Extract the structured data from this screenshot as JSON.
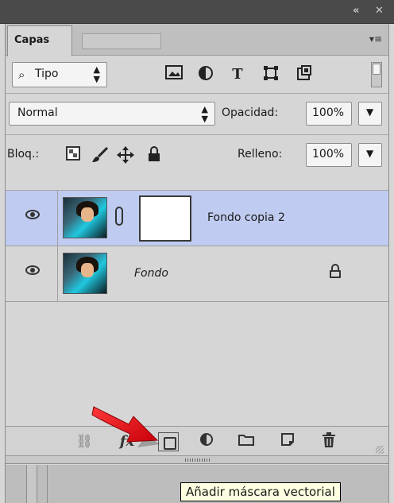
{
  "window": {
    "collapse_glyph": "«",
    "close_glyph": "✕"
  },
  "panel": {
    "tab_label": "Capas",
    "menu_glyph": "▾≡"
  },
  "filter": {
    "kind_label": "Tipo",
    "search_glyph": "⌕",
    "icons": [
      "image-filter-icon",
      "adjustment-filter-icon",
      "type-filter-icon",
      "shape-filter-icon",
      "smart-object-filter-icon"
    ],
    "type_glyph": "T"
  },
  "blend": {
    "mode": "Normal",
    "opacity_label": "Opacidad:",
    "opacity_value": "100%"
  },
  "lock": {
    "label": "Bloq.:",
    "fill_label": "Relleno:",
    "fill_value": "100%"
  },
  "layers": [
    {
      "name": "Fondo copia 2",
      "selected": true,
      "has_mask": true
    },
    {
      "name": "Fondo",
      "selected": false,
      "locked": true
    }
  ],
  "bottom_toolbar": {
    "fx_label": "fx",
    "icons": [
      "link-layers-icon",
      "layer-style-icon",
      "add-vector-mask-icon",
      "adjustment-layer-icon",
      "new-group-icon",
      "new-layer-icon",
      "delete-layer-icon"
    ]
  },
  "tooltip": {
    "text": "Añadir máscara vectorial"
  },
  "colors": {
    "selection": "#bfcbf0",
    "arrow": "#e0141c",
    "tooltip_bg": "#ffffe1"
  }
}
